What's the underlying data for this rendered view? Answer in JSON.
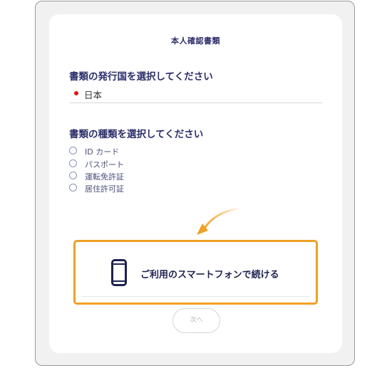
{
  "page": {
    "title": "本人確認書類"
  },
  "country_section": {
    "heading": "書類の発行国を選択してください",
    "selected_country": "日本",
    "flag": "japan-flag-icon"
  },
  "document_section": {
    "heading": "書類の種類を選択してください",
    "options": [
      {
        "label": "ID カード",
        "selected": false
      },
      {
        "label": "パスポート",
        "selected": false
      },
      {
        "label": "運転免許証",
        "selected": false
      },
      {
        "label": "居住許可証",
        "selected": false
      }
    ]
  },
  "cta": {
    "label": "ご利用のスマートフォンで続ける",
    "icon": "smartphone-icon",
    "highlight_color": "#f0a024"
  },
  "next_button": {
    "label": "次へ"
  },
  "colors": {
    "navy": "#2c2f6b",
    "orange": "#f0a024"
  }
}
